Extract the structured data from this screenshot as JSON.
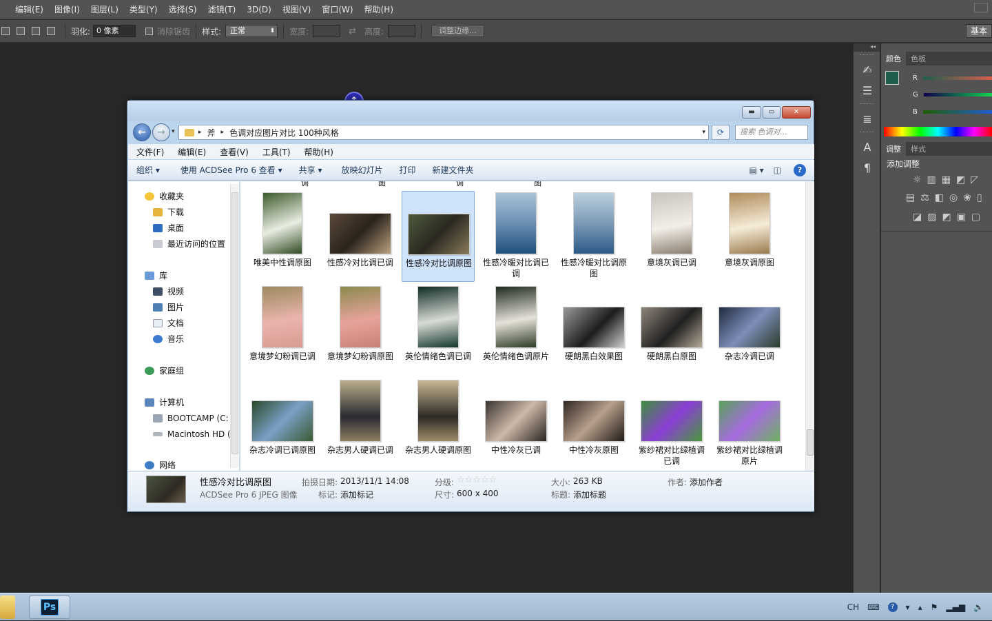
{
  "photoshop": {
    "menu": [
      "编辑(E)",
      "图像(I)",
      "图层(L)",
      "类型(Y)",
      "选择(S)",
      "滤镜(T)",
      "3D(D)",
      "视图(V)",
      "窗口(W)",
      "帮助(H)"
    ],
    "options": {
      "feather_label": "羽化:",
      "feather_value": "0 像素",
      "antialias_label": "消除锯齿",
      "style_label": "样式:",
      "style_value": "正常",
      "width_label": "宽度:",
      "height_label": "高度:",
      "refine_edge_label": "调整边缘..."
    },
    "workspace_button": "基本",
    "panels": {
      "color_tabs": [
        "颜色",
        "色板"
      ],
      "channels": [
        "R",
        "G",
        "B"
      ],
      "adjust_tabs": [
        "调整",
        "样式"
      ],
      "adjust_title": "添加调整"
    },
    "colors": {
      "foreground": "#1f5e4e",
      "accent": "#2a5ba8"
    }
  },
  "explorer": {
    "address": [
      "斧",
      "色调对应图片对比 100种风格"
    ],
    "search_placeholder": "搜索 色调对...",
    "menu": [
      "文件(F)",
      "编辑(E)",
      "查看(V)",
      "工具(T)",
      "帮助(H)"
    ],
    "commands": [
      "组织 ▾",
      "使用 ACDSee Pro 6 查看 ▾",
      "共享 ▾",
      "放映幻灯片",
      "打印",
      "新建文件夹"
    ],
    "nav": {
      "favorites": "收藏夹",
      "fav_items": [
        "下载",
        "桌面",
        "最近访问的位置"
      ],
      "library": "库",
      "lib_items": [
        "视频",
        "图片",
        "文档",
        "音乐"
      ],
      "homegroup": "家庭组",
      "computer": "计算机",
      "drives": [
        "BOOTCAMP (C:",
        "Macintosh HD ("
      ],
      "network": "网络"
    },
    "top_partial_labels": [
      "调",
      "图",
      "调",
      "图"
    ],
    "thumbnails": [
      {
        "label": "唯美中性调原图"
      },
      {
        "label": "性感冷对比调已调"
      },
      {
        "label": "性感冷对比调原图"
      },
      {
        "label": "性感冷暖对比调已调"
      },
      {
        "label": "性感冷暖对比调原图"
      },
      {
        "label": "意境灰调已调"
      },
      {
        "label": "意境灰调原图"
      },
      {
        "label": "意境梦幻粉调已调"
      },
      {
        "label": "意境梦幻粉调原图"
      },
      {
        "label": "英伦情绪色调已调"
      },
      {
        "label": "英伦情绪色调原片"
      },
      {
        "label": "硬朗黑白效果图"
      },
      {
        "label": "硬朗黑白原图"
      },
      {
        "label": "杂志冷调已调"
      },
      {
        "label": "杂志冷调已调原图"
      },
      {
        "label": "杂志男人硬调已调"
      },
      {
        "label": "杂志男人硬调原图"
      },
      {
        "label": "中性冷灰已调"
      },
      {
        "label": "中性冷灰原图"
      },
      {
        "label": "紫纱裙对比绿植调已调"
      },
      {
        "label": "紫纱裙对比绿植调原片"
      }
    ],
    "details": {
      "filename": "性感冷对比调原图",
      "filetype": "ACDSee Pro 6 JPEG 图像",
      "date_label": "拍摄日期:",
      "date_value": "2013/11/1 14:08",
      "tag_label": "标记:",
      "tag_value": "添加标记",
      "rating_label": "分级:",
      "rating_stars": 0,
      "dim_label": "尺寸:",
      "dim_value": "600 x 400",
      "size_label": "大小:",
      "size_value": "263 KB",
      "title_label": "标题:",
      "title_value": "添加标题",
      "author_label": "作者:",
      "author_value": "添加作者"
    }
  },
  "taskbar": {
    "ps_label": "Ps",
    "tray_ime": "CH"
  }
}
